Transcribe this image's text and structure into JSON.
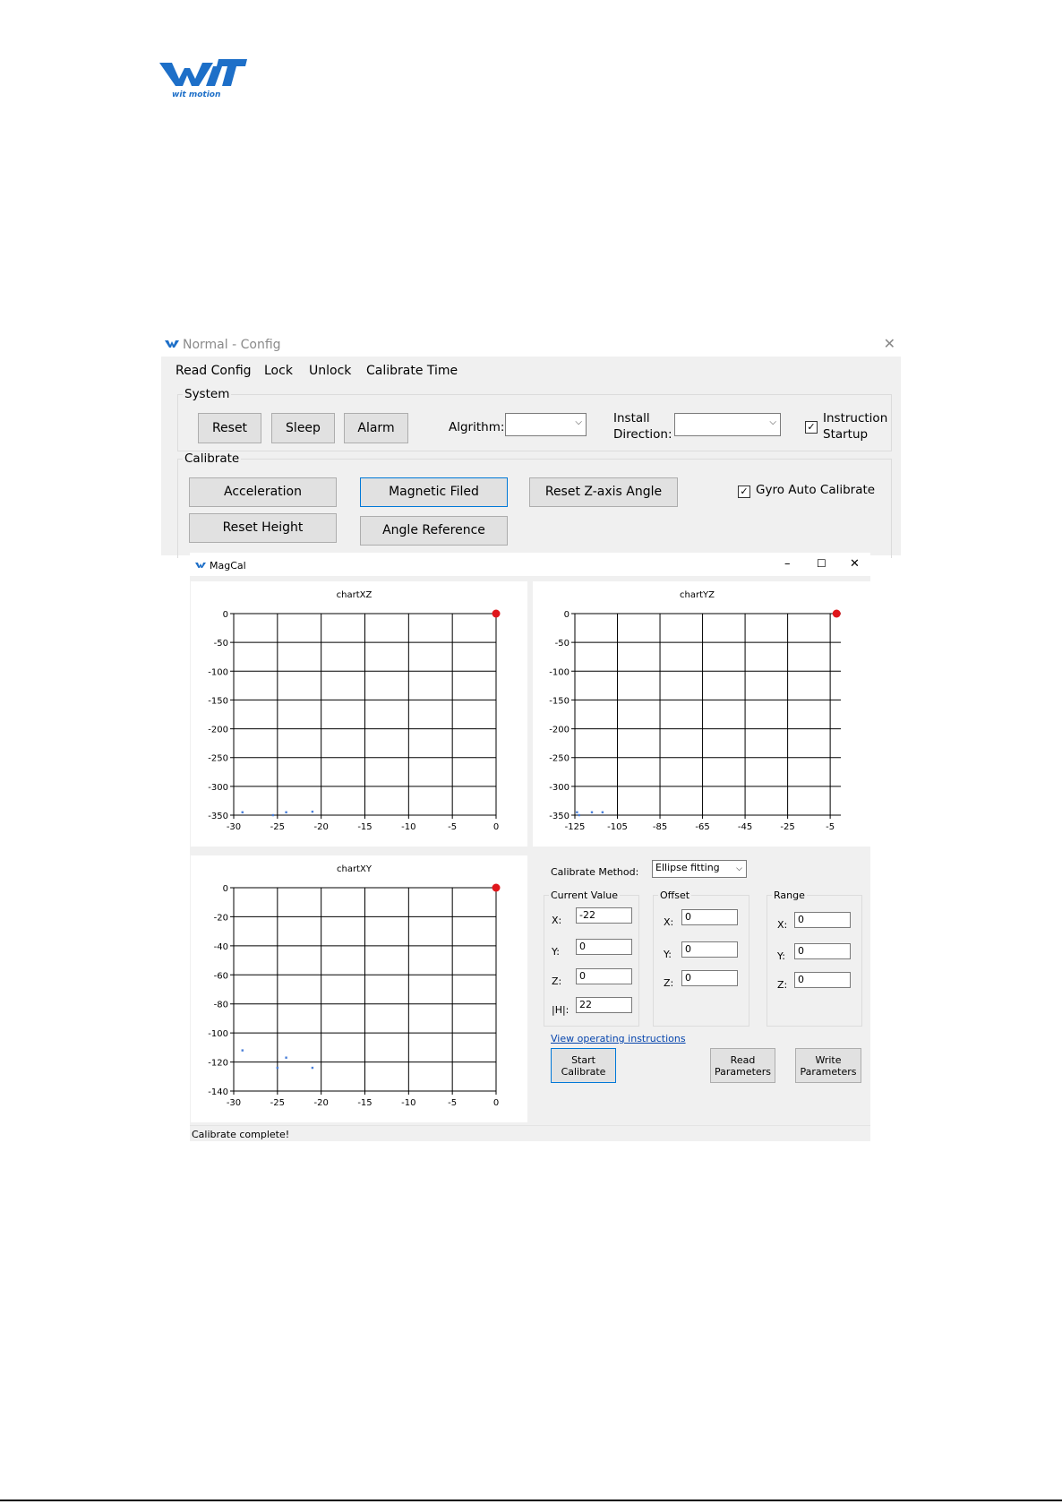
{
  "logo": {
    "text": "wit motion"
  },
  "config": {
    "title": "Normal - Config",
    "menu": [
      "Read Config",
      "Lock",
      "Unlock",
      "Calibrate Time"
    ],
    "system": {
      "label": "System",
      "buttons": [
        "Reset",
        "Sleep",
        "Alarm"
      ],
      "algorithm_label": "Algrithm:",
      "install_label_1": "Install",
      "install_label_2": "Direction:",
      "instruction_1": "Instruction",
      "instruction_2": "Startup"
    },
    "calibrate": {
      "label": "Calibrate",
      "buttons": [
        "Acceleration",
        "Magnetic Filed",
        "Reset Z-axis Angle",
        "Reset Height",
        "Angle Reference"
      ],
      "gyro_label": "Gyro Auto Calibrate"
    }
  },
  "magcal": {
    "title": "MagCal",
    "controls": {
      "minimize": "–",
      "maximize": "☐",
      "close": "✕"
    },
    "calibrate_method_label": "Calibrate Method:",
    "calibrate_method_value": "Ellipse fitting",
    "current_value": {
      "label": "Current Value",
      "x": "-22",
      "y": "0",
      "z": "0",
      "h": "22"
    },
    "offset": {
      "label": "Offset",
      "x": "0",
      "y": "0",
      "z": "0"
    },
    "range": {
      "label": "Range",
      "x": "0",
      "y": "0",
      "z": "0"
    },
    "field_labels": {
      "x": "X:",
      "y": "Y:",
      "z": "Z:",
      "h": "|H|:"
    },
    "instructions_link": "View operating instructions",
    "buttons": {
      "start": [
        "Start",
        "Calibrate"
      ],
      "read": [
        "Read",
        "Parameters"
      ],
      "write": [
        "Write",
        "Parameters"
      ]
    },
    "status": "Calibrate complete!"
  },
  "chart_data": [
    {
      "type": "scatter",
      "title": "chartXZ",
      "xlim": [
        -30,
        0
      ],
      "ylim": [
        -350,
        0
      ],
      "xticks": [
        -30,
        -25,
        -20,
        -15,
        -10,
        -5,
        0
      ],
      "yticks": [
        0,
        -50,
        -100,
        -150,
        -200,
        -250,
        -300,
        -350
      ],
      "points": [
        [
          -29,
          -345
        ],
        [
          -24,
          -345
        ],
        [
          -21,
          -344
        ],
        [
          -25.5,
          -350
        ]
      ],
      "current": [
        0,
        0
      ]
    },
    {
      "type": "scatter",
      "title": "chartYZ",
      "xlim": [
        -125,
        0
      ],
      "ylim": [
        -350,
        0
      ],
      "xticks": [
        -125,
        -105,
        -85,
        -65,
        -45,
        -25,
        -5
      ],
      "yticks": [
        0,
        -50,
        -100,
        -150,
        -200,
        -250,
        -300,
        -350
      ],
      "points": [
        [
          -124,
          -345
        ],
        [
          -123,
          -350
        ],
        [
          -117,
          -345
        ],
        [
          -112,
          -345
        ]
      ],
      "current": [
        -2,
        0
      ]
    },
    {
      "type": "scatter",
      "title": "chartXY",
      "xlim": [
        -30,
        0
      ],
      "ylim": [
        -140,
        0
      ],
      "xticks": [
        -30,
        -25,
        -20,
        -15,
        -10,
        -5,
        0
      ],
      "yticks": [
        0,
        -20,
        -40,
        -60,
        -80,
        -100,
        -120,
        -140
      ],
      "points": [
        [
          -29,
          -112
        ],
        [
          -24,
          -117
        ],
        [
          -21,
          -124
        ],
        [
          -25,
          -124
        ]
      ],
      "current": [
        0,
        0
      ]
    }
  ]
}
